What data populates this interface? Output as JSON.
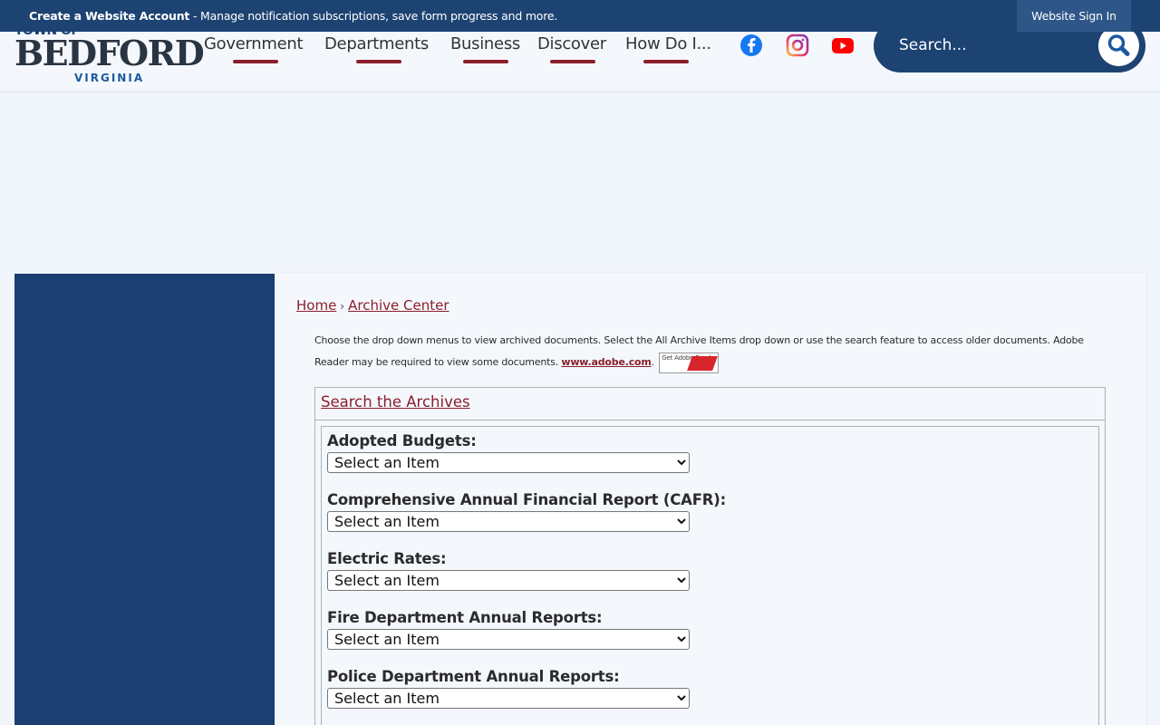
{
  "topbar": {
    "create_account": "Create a Website Account",
    "message": " - Manage notification subscriptions, save form progress and more.",
    "sign_in": "Website Sign In",
    "color": "#1d4372"
  },
  "logo": {
    "town": "TOWN OF",
    "name": "BEDFORD",
    "state": "VIRGINIA"
  },
  "nav": {
    "items": [
      {
        "label": "Government"
      },
      {
        "label": "Departments"
      },
      {
        "label": "Business"
      },
      {
        "label": "Discover"
      },
      {
        "label": "How Do I..."
      }
    ],
    "accent": "#8b1f2b"
  },
  "social": [
    "facebook-icon",
    "instagram-icon",
    "youtube-icon"
  ],
  "search": {
    "placeholder": "Search..."
  },
  "breadcrumb": {
    "home": "Home",
    "separator": "›",
    "current": "Archive Center"
  },
  "intro": {
    "text": "Choose the drop down menus to view archived documents. Select the All Archive Items drop down or use the search feature to access older documents. Adobe Reader may be required to view some documents.",
    "link": "www.adobe.com",
    "after_link": ".",
    "badge": "Get Adobe Reader"
  },
  "archive": {
    "heading": "Search the Archives",
    "fields": [
      {
        "label": "Adopted Budgets:",
        "selected": "Select an Item"
      },
      {
        "label": "Comprehensive Annual Financial Report (CAFR):",
        "selected": "Select an Item"
      },
      {
        "label": "Electric Rates:",
        "selected": "Select an Item"
      },
      {
        "label": "Fire Department Annual Reports:",
        "selected": "Select an Item"
      },
      {
        "label": "Police Department Annual Reports:",
        "selected": "Select an Item"
      }
    ]
  }
}
